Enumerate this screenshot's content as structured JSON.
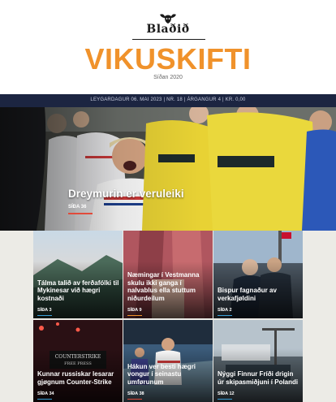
{
  "brand": {
    "logo_text": "Blaðið"
  },
  "header": {
    "title": "VIKUSKIFTI",
    "since": "Síðan 2020"
  },
  "info_bar": {
    "text": "LEYGARDAGUR 06. MAI 2023 | NR. 18 | ÁRGANGUR 4 | KR. 0,00"
  },
  "hero": {
    "title": "Dreymurin er veruleiki",
    "page": "SÍÐA 36",
    "underline_color": "#e14b3b"
  },
  "cards": [
    {
      "title": "Tálma talið av ferðafólki til Mykinesar við hægri kostnaði",
      "page": "SÍÐA 3",
      "underline_color": "#3aa0d8"
    },
    {
      "title": "Næmingar í Vestmanna skulu ikki ganga í nalvablus ella stuttum niðurdeilum",
      "page": "SÍÐA 9",
      "underline_color": "#f0922b"
    },
    {
      "title": "Bispur fagnaður av verkafjøldini",
      "page": "SÍÐA 2",
      "underline_color": "#3aa0d8"
    },
    {
      "title": "Kunnar russiskar lesarar gjøgnum Counter-Strike",
      "page": "SÍÐA 34",
      "underline_color": "#3aa0d8"
    },
    {
      "title": "Hákun ver besti hægri vongur í seinastu umførunum",
      "page": "SÍÐA 38",
      "underline_color": "#e14b3b"
    },
    {
      "title": "Nýggi Finnur Fríði drigin úr skipasmiðjuni í Polandi",
      "page": "SÍÐA 12",
      "underline_color": "#3aa0d8"
    }
  ],
  "colors": {
    "accent": "#f0922b",
    "navy": "#1c2541",
    "red": "#e14b3b",
    "blue": "#3aa0d8"
  }
}
